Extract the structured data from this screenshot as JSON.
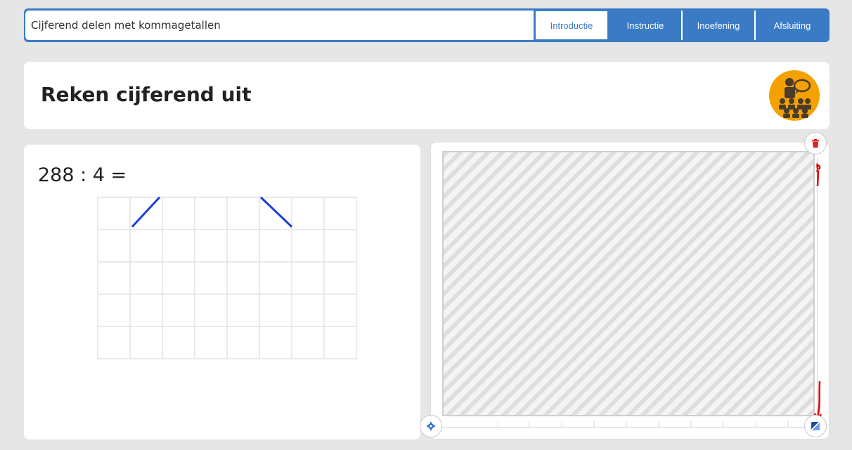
{
  "header": {
    "lesson_title": "Cijferend delen met kommagetallen",
    "tabs": [
      {
        "label": "Introductie",
        "active": true
      },
      {
        "label": "Instructie",
        "active": false
      },
      {
        "label": "Inoefening",
        "active": false
      },
      {
        "label": "Afsluiting",
        "active": false
      }
    ]
  },
  "main": {
    "heading": "Reken cijferend uit",
    "avatar_icon": "teacher-classroom-icon"
  },
  "exercise": {
    "problem": "288 : 4 ="
  },
  "whiteboard": {
    "delete_icon": "trash-icon",
    "settings_icon": "gear-icon",
    "resize_icon": "resize-icon"
  },
  "colors": {
    "accent": "#3b7bc6",
    "avatar_bg": "#f5a100",
    "division_lines": "#1a3fd6",
    "annotation": "#e00000"
  }
}
